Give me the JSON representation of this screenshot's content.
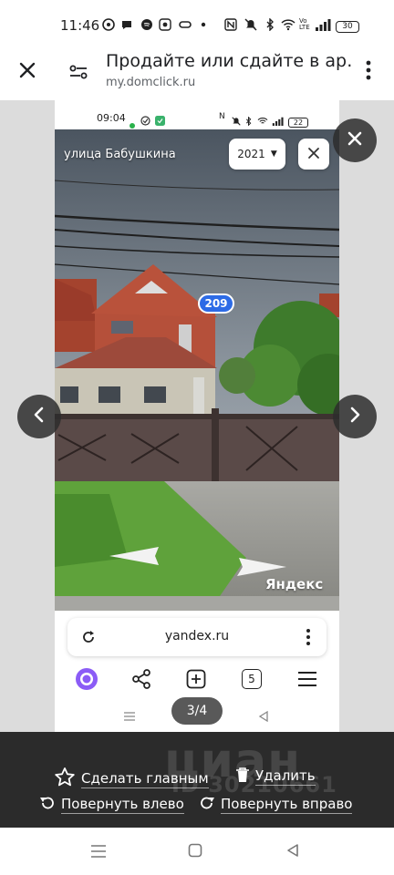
{
  "status_bar": {
    "time": "11:46",
    "battery": "30"
  },
  "browser": {
    "title": "Продайте или сдайте в ар…",
    "domain": "my.domclick.ru"
  },
  "screenshot": {
    "status_time": "09:04",
    "battery": "22",
    "street_name": "улица Бабушкина",
    "year": "2021",
    "house_number": "209",
    "watermark": "Яндекс",
    "url": "yandex.ru",
    "tab_count": "5"
  },
  "gallery": {
    "counter": "3/4"
  },
  "actions": {
    "make_main": "Сделать главным",
    "delete": "Удалить",
    "rotate_left": "Повернуть влево",
    "rotate_right": "Повернуть вправо"
  },
  "watermark": {
    "brand": "циан",
    "id": "ID 30210661"
  },
  "colors": {
    "accent_blue": "#2d6be6",
    "panel_dark": "#2b2b2b",
    "alice_purple": "#8b5cf6"
  }
}
